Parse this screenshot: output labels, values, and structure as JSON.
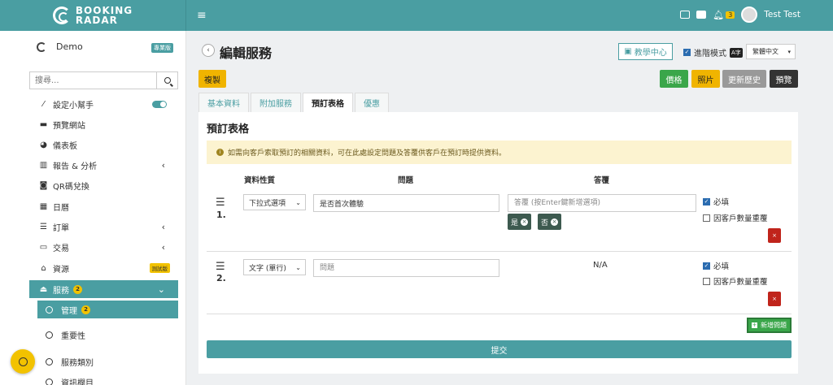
{
  "brand": {
    "line1": "BOOKING",
    "line2": "RADAR"
  },
  "topbar": {
    "notif_count": "3",
    "username": "Test Test"
  },
  "sidebar": {
    "account": "Demo",
    "plan_badge": "專業版",
    "search_placeholder": "搜尋...",
    "items": [
      {
        "label": "設定小幫手",
        "icon": "magic-wand-icon"
      },
      {
        "label": "預覽網站",
        "icon": "browser-icon"
      },
      {
        "label": "儀表板",
        "icon": "dashboard-icon"
      },
      {
        "label": "報告 & 分析",
        "icon": "chart-icon"
      },
      {
        "label": "QR碼兌換",
        "icon": "camera-icon"
      },
      {
        "label": "日曆",
        "icon": "calendar-icon"
      },
      {
        "label": "訂單",
        "icon": "list-check-icon"
      },
      {
        "label": "交易",
        "icon": "credit-card-icon"
      },
      {
        "label": "資源",
        "icon": "bank-icon",
        "badge": "測試版"
      },
      {
        "label": "服務",
        "icon": "service-icon",
        "badge": "2"
      }
    ],
    "subitems": [
      {
        "label": "管理",
        "badge": "2"
      },
      {
        "label": "重要性"
      },
      {
        "label": "服務類別"
      },
      {
        "label": "資訊欄目"
      }
    ]
  },
  "page": {
    "title": "編輯服務",
    "tutorial": "教學中心",
    "advanced_mode": "進階模式",
    "language": "繁體中文",
    "language_icon": "A字"
  },
  "actions": {
    "copy": "複製",
    "price": "價格",
    "photo": "照片",
    "history": "更新歷史",
    "preview": "預覽"
  },
  "tabs": [
    "基本資料",
    "附加服務",
    "預訂表格",
    "優惠"
  ],
  "form": {
    "title": "預訂表格",
    "info": "如需向客戶索取預訂的相關資料，可在此處設定問題及答覆供客戶在預訂時提供資料。",
    "col_type": "資料性質",
    "col_question": "問題",
    "col_answer": "答覆",
    "rows": [
      {
        "num": "1.",
        "type": "下拉式選項",
        "question": "是否首次體驗",
        "answer_placeholder": "答覆 (按Enter鍵新增選項)",
        "chips": [
          "是",
          "否"
        ],
        "required": "必填",
        "repeat": "因客戶數量重覆"
      },
      {
        "num": "2.",
        "type": "文字 (單行)",
        "question_placeholder": "問題",
        "answer": "N/A",
        "required": "必填",
        "repeat": "因客戶數量重覆"
      }
    ],
    "add_question": "新增問題",
    "submit": "提交"
  }
}
